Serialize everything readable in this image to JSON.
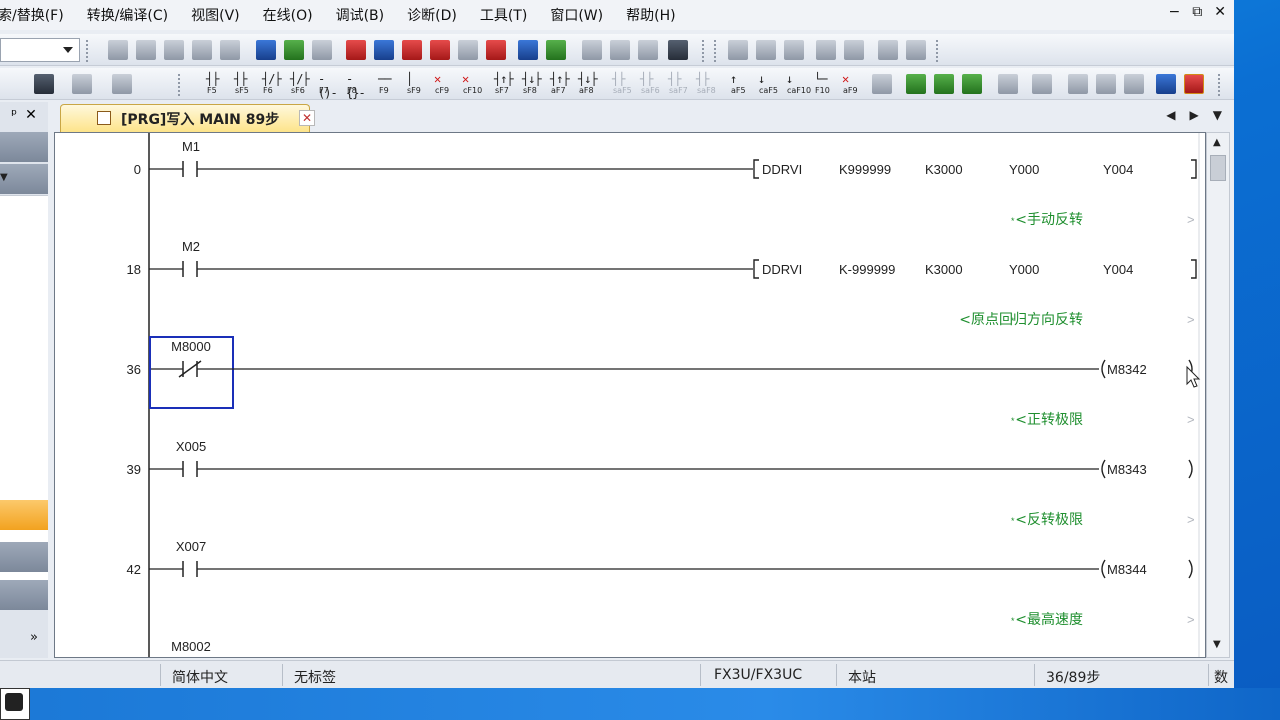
{
  "menu": {
    "items": [
      "索/替换(F)",
      "转换/编译(C)",
      "视图(V)",
      "在线(O)",
      "调试(B)",
      "诊断(D)",
      "工具(T)",
      "窗口(W)",
      "帮助(H)"
    ],
    "window_controls": [
      "−",
      "⧉",
      "✕"
    ]
  },
  "toolbar2": {
    "ladder_buttons": [
      {
        "sym": "┤├",
        "key": "F5"
      },
      {
        "sym": "┤├",
        "key": "sF5"
      },
      {
        "sym": "┤/├",
        "key": "F6"
      },
      {
        "sym": "┤/├",
        "key": "sF6"
      },
      {
        "sym": "-()-",
        "key": "F7"
      },
      {
        "sym": "-{}-",
        "key": "F8"
      },
      {
        "sym": "──",
        "key": "F9"
      },
      {
        "sym": "│",
        "key": "sF9"
      },
      {
        "sym": "✕",
        "key": "cF9",
        "style": "red"
      },
      {
        "sym": "✕",
        "key": "cF10",
        "style": "red"
      },
      {
        "sym": "┤↑├",
        "key": "sF7"
      },
      {
        "sym": "┤↓├",
        "key": "sF8"
      },
      {
        "sym": "┤↑├",
        "key": "aF7"
      },
      {
        "sym": "┤↓├",
        "key": "aF8"
      },
      {
        "sym": "┤├",
        "key": "saF5",
        "style": "dim"
      },
      {
        "sym": "┤├",
        "key": "saF6",
        "style": "dim"
      },
      {
        "sym": "┤├",
        "key": "saF7",
        "style": "dim"
      },
      {
        "sym": "┤├",
        "key": "saF8",
        "style": "dim"
      },
      {
        "sym": "↑",
        "key": "aF5"
      },
      {
        "sym": "↓",
        "key": "caF5"
      },
      {
        "sym": "↓",
        "key": "caF10"
      },
      {
        "sym": "└─",
        "key": "F10"
      },
      {
        "sym": "✕",
        "key": "aF9",
        "style": "red"
      }
    ]
  },
  "side_panel": {
    "pin": "ᵖ",
    "close": "✕",
    "more": "»"
  },
  "tab": {
    "label": "[PRG]写入 MAIN 89步",
    "close": "✕",
    "nav_prev": "◀",
    "nav_next": "▶",
    "nav_menu": "▼"
  },
  "ladder": {
    "rungs": [
      {
        "step": "0",
        "contact_label": "M1",
        "contact_type": "NO",
        "output_type": "instruction",
        "instruction": "DDRVI",
        "operands": [
          "K999999",
          "K3000",
          "Y000",
          "Y004"
        ],
        "comment": "<手动反转"
      },
      {
        "step": "18",
        "contact_label": "M2",
        "contact_type": "NO",
        "output_type": "instruction",
        "instruction": "DDRVI",
        "operands": [
          "K-999999",
          "K3000",
          "Y000",
          "Y004"
        ],
        "comment": "<原点回归方向反转"
      },
      {
        "step": "36",
        "contact_label": "M8000",
        "contact_type": "NC",
        "output_type": "coil",
        "coil": "M8342",
        "comment": "<正转极限",
        "selected": true
      },
      {
        "step": "39",
        "contact_label": "X005",
        "contact_type": "NO",
        "output_type": "coil",
        "coil": "M8343",
        "comment": "<反转极限"
      },
      {
        "step": "42",
        "contact_label": "X007",
        "contact_type": "NO",
        "output_type": "coil",
        "coil": "M8344",
        "comment": "<最高速度"
      },
      {
        "step": "",
        "contact_label": "M8002",
        "contact_type": "NO",
        "output_type": "none",
        "comment": ""
      }
    ]
  },
  "statusbar": {
    "language": "简体中文",
    "label": "无标签",
    "plc_type": "FX3U/FX3UC",
    "station": "本站",
    "steps": "36/89步",
    "mode": "数"
  },
  "colors": {
    "comment_green": "#1f8f2f",
    "selection_blue": "#1a2fb8",
    "tab_accent": "#fde48a"
  }
}
